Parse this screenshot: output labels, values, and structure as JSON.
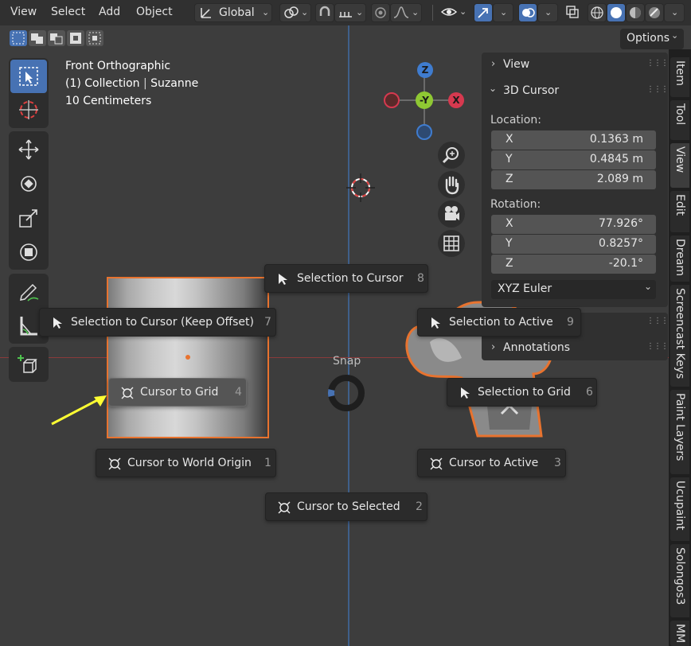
{
  "header": {
    "menus": [
      "View",
      "Select",
      "Add",
      "Object"
    ],
    "transform_orientation": "Global"
  },
  "options_label": "Options",
  "viewport_info": {
    "view_name": "Front Orthographic",
    "collection": "(1) Collection",
    "object": "Suzanne",
    "scale": "10 Centimeters"
  },
  "gizmo": {
    "z": "Z",
    "neg_y": "-Y",
    "x": "X"
  },
  "pie_menu": {
    "title": "Snap",
    "items": [
      {
        "label": "Selection to Cursor",
        "key": "8",
        "icon": "cursor-arrow-icon"
      },
      {
        "label": "Selection to Cursor (Keep Offset)",
        "key": "7",
        "icon": "cursor-arrow-icon"
      },
      {
        "label": "Selection to Active",
        "key": "9",
        "icon": "cursor-arrow-icon"
      },
      {
        "label": "Cursor to Grid",
        "key": "4",
        "icon": "3d-cursor-icon"
      },
      {
        "label": "Selection to Grid",
        "key": "6",
        "icon": "cursor-arrow-icon"
      },
      {
        "label": "Cursor to World Origin",
        "key": "1",
        "icon": "3d-cursor-icon"
      },
      {
        "label": "Cursor to Active",
        "key": "3",
        "icon": "3d-cursor-icon"
      },
      {
        "label": "Cursor to Selected",
        "key": "2",
        "icon": "3d-cursor-icon"
      }
    ]
  },
  "sidebar": {
    "view_panel": "View",
    "cursor_panel": "3D Cursor",
    "location_label": "Location:",
    "location": {
      "x_label": "X",
      "x": "0.1363 m",
      "y_label": "Y",
      "y": "0.4845 m",
      "z_label": "Z",
      "z": "2.089 m"
    },
    "rotation_label": "Rotation:",
    "rotation": {
      "x_label": "X",
      "x": "77.926°",
      "y_label": "Y",
      "y": "0.8257°",
      "z_label": "Z",
      "z": "-20.1°"
    },
    "rotation_mode": "XYZ Euler",
    "annotations_panel": "Annotations"
  },
  "tabs": [
    "Item",
    "Tool",
    "View",
    "Edit",
    "Dream",
    "Screencast Keys",
    "Paint Layers",
    "Ucupaint",
    "Solongos3",
    "MM"
  ],
  "colors": {
    "accent": "#4772b3",
    "selection_outline": "#e8732f",
    "axis_x": "#d6394f",
    "axis_y": "#8fc833",
    "axis_z": "#3f7ccf",
    "annotation_arrow": "#ffff33"
  }
}
